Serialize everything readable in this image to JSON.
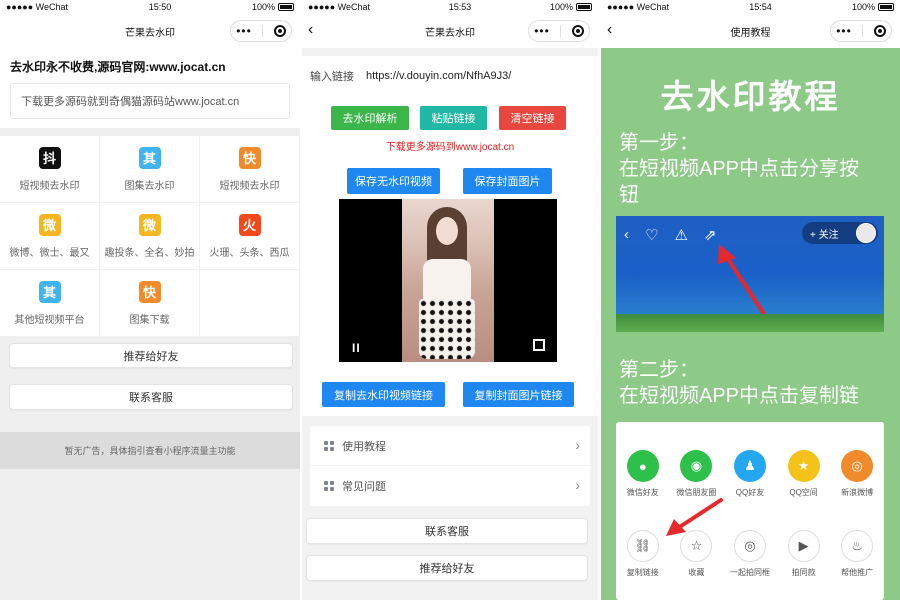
{
  "status_bars": [
    {
      "carrier": "●●●●● WeChat",
      "wifi": "wifi",
      "time": "15:50",
      "battery": "100%"
    },
    {
      "carrier": "●●●●● WeChat",
      "wifi": "wifi",
      "time": "15:53",
      "battery": "100%"
    },
    {
      "carrier": "●●●●● WeChat",
      "wifi": "wifi",
      "time": "15:54",
      "battery": "100%"
    }
  ],
  "panel1": {
    "nav_title": "芒果去水印",
    "headline": "去水印永不收费,源码官网:www.jocat.cn",
    "input_text": "下载更多源码就到奇偶猫源码站www.jocat.cn",
    "grid": [
      {
        "icon": "抖",
        "color": "#111111",
        "label": "短视频去水印"
      },
      {
        "icon": "其",
        "color": "#3fb4f0",
        "label": "图集去水印"
      },
      {
        "icon": "快",
        "color": "#f08a2a",
        "label": "短视频去水印"
      },
      {
        "icon": "微",
        "color": "#f5b620",
        "label": "微博、微士、最又"
      },
      {
        "icon": "微",
        "color": "#f5b620",
        "label": "趣投条、全名、妙拍"
      },
      {
        "icon": "火",
        "color": "#f04a1a",
        "label": "火珊、头条、西瓜"
      },
      {
        "icon": "其",
        "color": "#3fb4f0",
        "label": "其他短视频平台"
      },
      {
        "icon": "快",
        "color": "#f08a2a",
        "label": "图集下载"
      }
    ],
    "recommend_button": "推荐给好友",
    "contact_button": "联系客服",
    "footer": "暂无广告，具体指引查看小程序流量主功能"
  },
  "panel2": {
    "nav_title": "芒果去水印",
    "input_label": "输入链接",
    "input_value": "https://v.douyin.com/NfhA9J3/",
    "btn_parse": "去水印解析",
    "btn_paste": "粘贴链接",
    "btn_clear": "清空链接",
    "red_note": "下载更多源码到www.jocat.cn",
    "btn_save_video": "保存无水印视频",
    "btn_save_cover": "保存封面图片",
    "video_pause": "II",
    "btn_copy_video": "复制去水印视频链接",
    "btn_copy_cover": "复制封面图片链接",
    "menu": [
      {
        "label": "使用教程"
      },
      {
        "label": "常见问题"
      }
    ],
    "contact_button": "联系客服",
    "recommend_button": "推荐给好友",
    "colors": {
      "green": "#3cb54a",
      "teal": "#1fb8a5",
      "red": "#e8473f",
      "blue": "#1e88f0"
    }
  },
  "panel3": {
    "nav_title": "使用教程",
    "title": "去水印教程",
    "step1_line1": "第一步：",
    "step1_line2": "在短视频APP中点击分享按钮",
    "follow_label": "+ 关注",
    "step2_line1": "第二步：",
    "step2_line2": "在短视频APP中点击复制链接",
    "share_row1": [
      {
        "label": "微信好友",
        "color": "#2ec14a",
        "icon": "wechat-icon"
      },
      {
        "label": "微信朋友圈",
        "color": "#2ec14a",
        "icon": "moments-icon"
      },
      {
        "label": "QQ好友",
        "color": "#22a7f0",
        "icon": "qq-icon"
      },
      {
        "label": "QQ空间",
        "color": "#f5c21a",
        "icon": "star-icon"
      },
      {
        "label": "新浪微博",
        "color": "#f08a2a",
        "icon": "weibo-icon"
      }
    ],
    "share_row2": [
      {
        "label": "复制链接",
        "icon": "link-icon"
      },
      {
        "label": "收藏",
        "icon": "star-outline-icon"
      },
      {
        "label": "一起拍同框",
        "icon": "duet-icon"
      },
      {
        "label": "拍同款",
        "icon": "video-icon"
      },
      {
        "label": "帮他推广",
        "icon": "fire-icon"
      }
    ]
  }
}
